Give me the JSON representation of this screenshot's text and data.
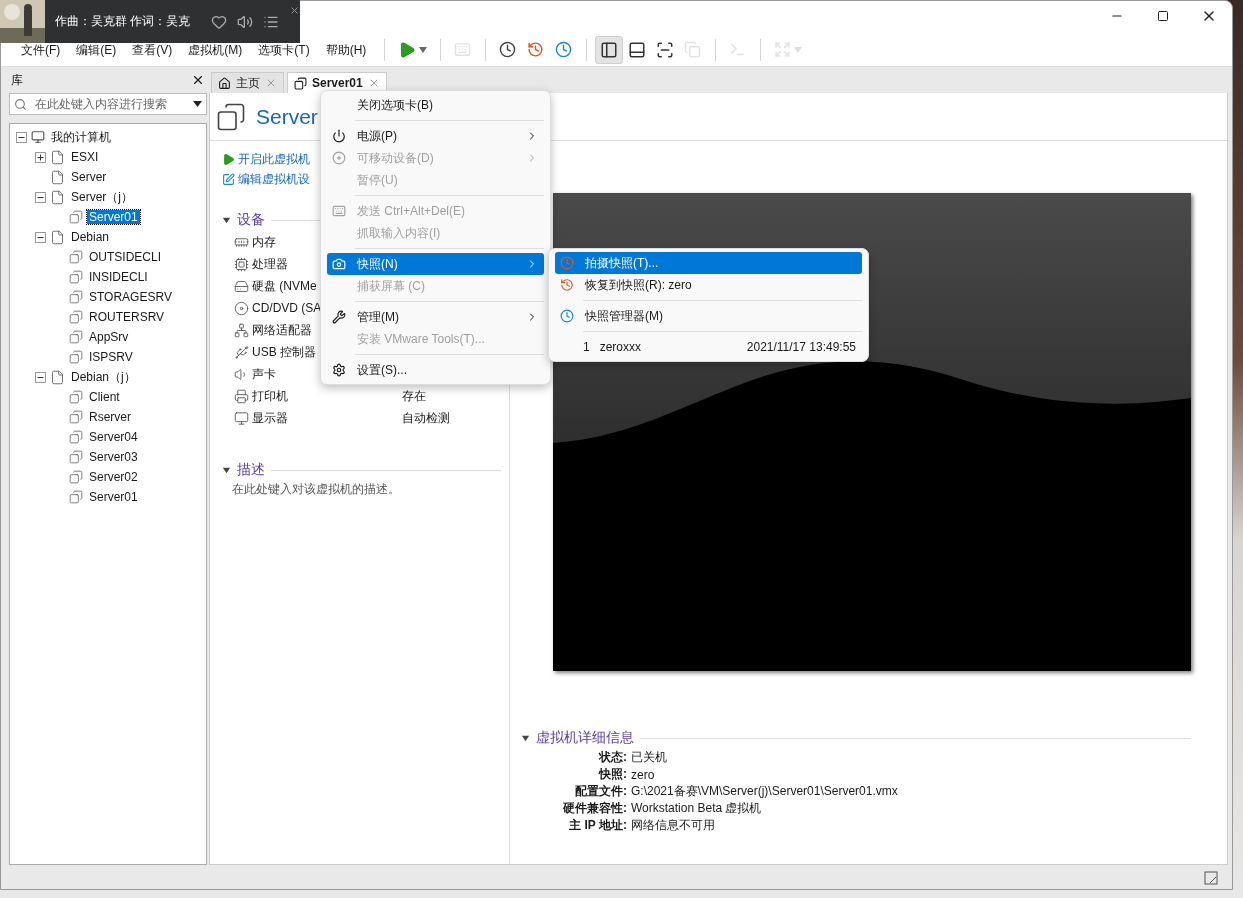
{
  "music_widget": {
    "lyrics": "作曲：吴克群 作词：吴克"
  },
  "menu_bar": [
    "文件(F)",
    "编辑(E)",
    "查看(V)",
    "虚拟机(M)",
    "选项卡(T)",
    "帮助(H)"
  ],
  "toolbar": [
    {
      "kind": "play",
      "disabled": false,
      "selected": false
    },
    {
      "kind": "send-keys",
      "disabled": true,
      "selected": false
    },
    {
      "kind": "take-snapshot",
      "disabled": false,
      "selected": false
    },
    {
      "kind": "revert-snapshot",
      "disabled": false,
      "selected": false
    },
    {
      "kind": "snapshot-manager",
      "disabled": false,
      "selected": false
    },
    {
      "kind": "library-view",
      "disabled": false,
      "selected": true
    },
    {
      "kind": "thumbnail-bar",
      "disabled": false,
      "selected": false
    },
    {
      "kind": "fullscreen",
      "disabled": false,
      "selected": false
    },
    {
      "kind": "unity",
      "disabled": true,
      "selected": false
    },
    {
      "kind": "console",
      "disabled": true,
      "selected": false
    },
    {
      "kind": "stretch",
      "disabled": true,
      "selected": false
    }
  ],
  "library": {
    "title": "库",
    "search_placeholder": "在此处键入内容进行搜索",
    "tree": [
      {
        "label": "我的计算机",
        "kind": "computer",
        "expanded": true,
        "selected": false,
        "children": [
          {
            "label": "ESXI",
            "kind": "folder",
            "expanded": false,
            "selected": false
          },
          {
            "label": "Server",
            "kind": "folder",
            "selected": false
          },
          {
            "label": "Server（j）",
            "kind": "folder",
            "expanded": true,
            "selected": false,
            "children": [
              {
                "label": "Server01",
                "kind": "vm",
                "selected": true
              }
            ]
          },
          {
            "label": "Debian",
            "kind": "folder",
            "expanded": true,
            "selected": false,
            "children": [
              {
                "label": "OUTSIDECLI",
                "kind": "vm",
                "selected": false
              },
              {
                "label": "INSIDECLI",
                "kind": "vm",
                "selected": false
              },
              {
                "label": "STORAGESRV",
                "kind": "vm",
                "selected": false
              },
              {
                "label": "ROUTERSRV",
                "kind": "vm",
                "selected": false
              },
              {
                "label": "AppSrv",
                "kind": "vm",
                "selected": false
              },
              {
                "label": "ISPSRV",
                "kind": "vm",
                "selected": false
              }
            ]
          },
          {
            "label": "Debian（j）",
            "kind": "folder",
            "expanded": true,
            "selected": false,
            "children": [
              {
                "label": "Client",
                "kind": "vm",
                "selected": false
              },
              {
                "label": "Rserver",
                "kind": "vm",
                "selected": false
              },
              {
                "label": "Server04",
                "kind": "vm",
                "selected": false
              },
              {
                "label": "Server03",
                "kind": "vm",
                "selected": false
              },
              {
                "label": "Server02",
                "kind": "vm",
                "selected": false
              },
              {
                "label": "Server01",
                "kind": "vm",
                "selected": false
              }
            ]
          }
        ]
      }
    ]
  },
  "tabs": [
    {
      "label": "主页",
      "kind": "home",
      "selected": false
    },
    {
      "label": "Server01",
      "kind": "vm",
      "selected": true
    }
  ],
  "vm_title": "Server",
  "actions": [
    {
      "label": "开启此虚拟机",
      "kind": "play"
    },
    {
      "label": "编辑虚拟机设",
      "kind": "edit"
    }
  ],
  "devices": {
    "title": "设备",
    "expanded": true,
    "items": [
      {
        "name": "内存",
        "kind": "memory"
      },
      {
        "name": "处理器",
        "kind": "cpu"
      },
      {
        "name": "硬盘 (NVMe",
        "kind": "disk"
      },
      {
        "name": "CD/DVD (SA",
        "kind": "cd"
      },
      {
        "name": "网络适配器",
        "kind": "network"
      },
      {
        "name": "USB 控制器",
        "kind": "usb"
      },
      {
        "name": "声卡",
        "kind": "sound"
      },
      {
        "name": "打印机",
        "kind": "printer",
        "value": "存在"
      },
      {
        "name": "显示器",
        "kind": "display",
        "value": "自动检测"
      }
    ]
  },
  "description": {
    "title": "描述",
    "expanded": true,
    "text": "在此处键入对该虚拟机的描述。"
  },
  "details": {
    "title": "虚拟机详细信息",
    "expanded": true,
    "rows": [
      {
        "label": "状态:",
        "value": "已关机"
      },
      {
        "label": "快照:",
        "value": "zero"
      },
      {
        "label": "配置文件:",
        "value": "G:\\2021备赛\\VM\\Server(j)\\Server01\\Server01.vmx"
      },
      {
        "label": "硬件兼容性:",
        "value": "Workstation Beta 虚拟机"
      },
      {
        "label": "主 IP 地址:",
        "value": "网络信息不可用"
      }
    ]
  },
  "context_menu": {
    "items": [
      {
        "kind": "item",
        "label": "关闭选项卡(B)",
        "disabled": false,
        "submenu": false,
        "selected": false
      },
      {
        "kind": "separator"
      },
      {
        "kind": "item",
        "label": "电源(P)",
        "disabled": false,
        "submenu": true,
        "selected": false
      },
      {
        "kind": "item",
        "label": "可移动设备(D)",
        "disabled": true,
        "submenu": true,
        "selected": false
      },
      {
        "kind": "item",
        "label": "暂停(U)",
        "disabled": true,
        "submenu": false,
        "selected": false
      },
      {
        "kind": "separator"
      },
      {
        "kind": "item",
        "label": "发送 Ctrl+Alt+Del(E)",
        "disabled": true,
        "submenu": false,
        "selected": false
      },
      {
        "kind": "item",
        "label": "抓取输入内容(I)",
        "disabled": true,
        "submenu": false,
        "selected": false
      },
      {
        "kind": "separator"
      },
      {
        "kind": "item",
        "label": "快照(N)",
        "disabled": false,
        "submenu": true,
        "selected": true
      },
      {
        "kind": "item",
        "label": "捕获屏幕 (C)",
        "disabled": true,
        "submenu": false,
        "selected": false
      },
      {
        "kind": "separator"
      },
      {
        "kind": "item",
        "label": "管理(M)",
        "disabled": false,
        "submenu": true,
        "selected": false
      },
      {
        "kind": "item",
        "label": "安装 VMware Tools(T)...",
        "disabled": true,
        "submenu": false,
        "selected": false
      },
      {
        "kind": "separator"
      },
      {
        "kind": "item",
        "label": "设置(S)...",
        "disabled": false,
        "submenu": false,
        "selected": false
      }
    ]
  },
  "snapshot_menu": {
    "items": [
      {
        "kind": "item",
        "label": "拍摄快照(T)...",
        "selected": true
      },
      {
        "kind": "item",
        "label": "恢复到快照(R): zero",
        "selected": false
      },
      {
        "kind": "separator"
      },
      {
        "kind": "item",
        "label": "快照管理器(M)",
        "selected": false
      },
      {
        "kind": "separator"
      },
      {
        "kind": "snapshot",
        "number": "1",
        "label": "zeroxxx",
        "date": "2021/11/17 13:49:55",
        "selected": false
      }
    ]
  }
}
